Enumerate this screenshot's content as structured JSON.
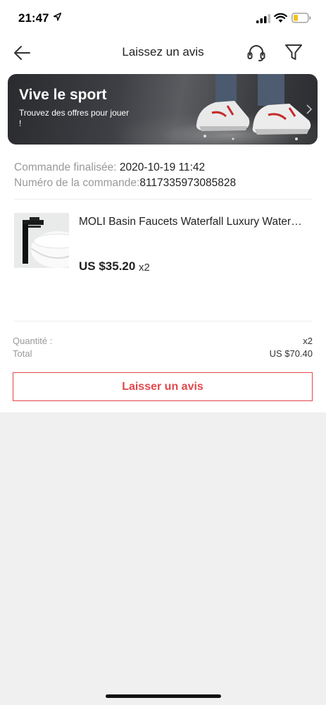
{
  "status_bar": {
    "time": "21:47"
  },
  "nav": {
    "title": "Laissez un avis"
  },
  "banner": {
    "title": "Vive le sport",
    "subtitle": "Trouvez des offres pour jouer !"
  },
  "order": {
    "completed_label": "Commande finalisée: ",
    "completed_value": "2020-10-19 11:42",
    "number_label": "Numéro de la commande:",
    "number_value": "8117335973085828"
  },
  "product": {
    "title": "MOLI Basin Faucets Waterfall Luxury Water…",
    "price": "US $35.20",
    "quantity": "x2"
  },
  "summary": {
    "quantity_label": "Quantité :",
    "quantity_value": "x2",
    "total_label": "Total",
    "total_value": "US $70.40"
  },
  "action": {
    "review_label": "Laisser un avis"
  },
  "colors": {
    "accent": "#e2474b",
    "background": "#f0f0f0"
  }
}
